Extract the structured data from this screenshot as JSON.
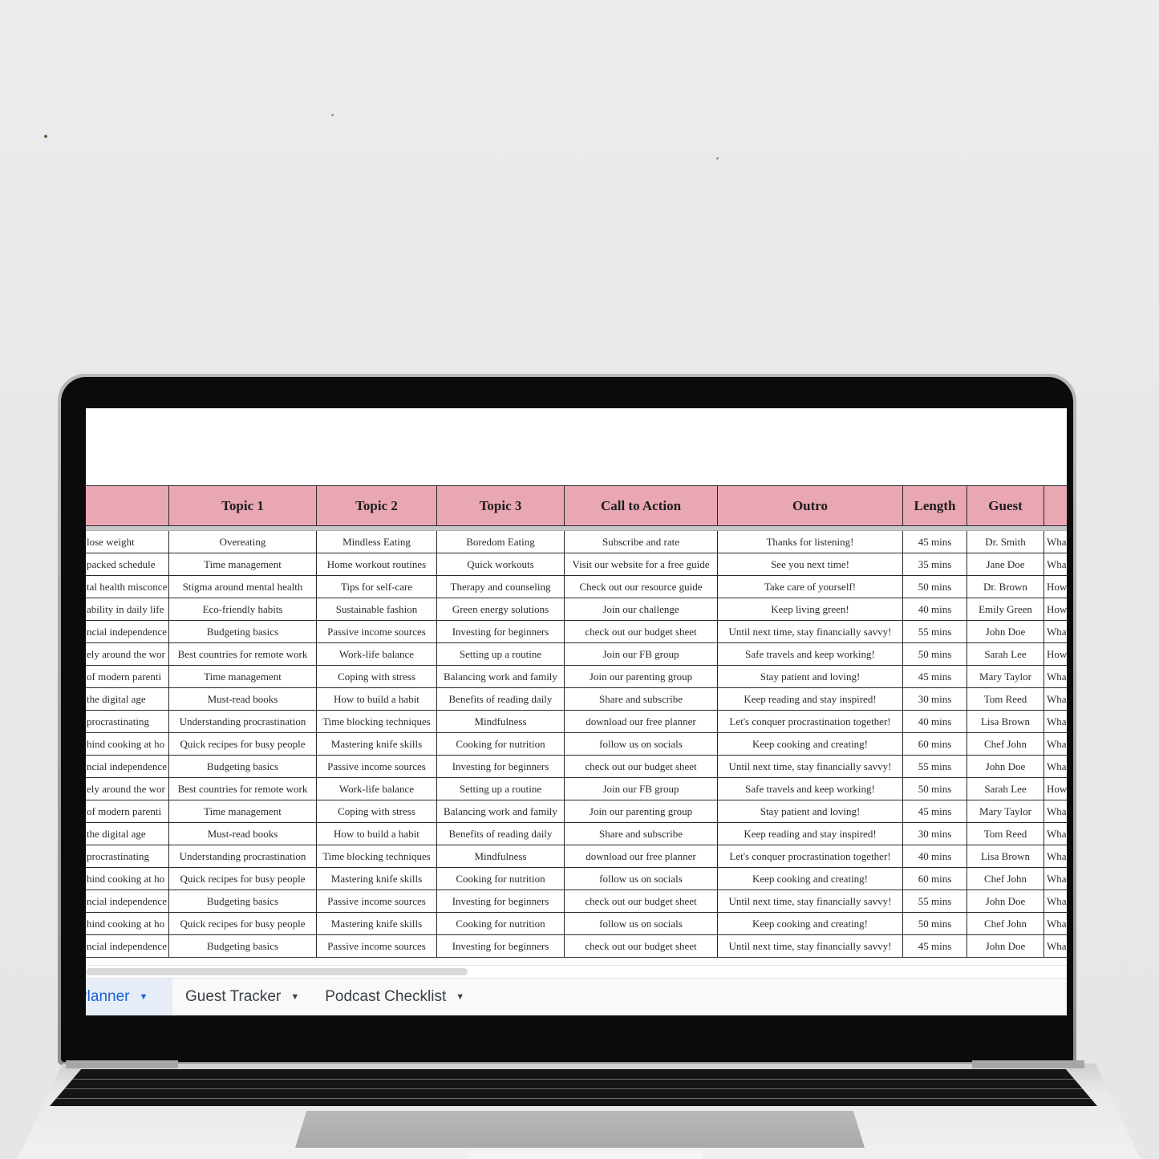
{
  "spreadsheet": {
    "columns": [
      {
        "label": ""
      },
      {
        "label": "Topic 1"
      },
      {
        "label": "Topic 2"
      },
      {
        "label": "Topic 3"
      },
      {
        "label": "Call to Action"
      },
      {
        "label": "Outro"
      },
      {
        "label": "Length"
      },
      {
        "label": "Guest"
      },
      {
        "label": ""
      }
    ],
    "rows": [
      [
        "lose weight",
        "Overeating",
        "Mindless Eating",
        "Boredom Eating",
        "Subscribe and rate",
        "Thanks for listening!",
        "45 mins",
        "Dr. Smith",
        "Wha"
      ],
      [
        "packed schedule",
        "Time management",
        "Home workout routines",
        "Quick workouts",
        "Visit our website for a free guide",
        "See you next time!",
        "35 mins",
        "Jane Doe",
        "Wha"
      ],
      [
        "tal health misconce",
        "Stigma around mental health",
        "Tips for self-care",
        "Therapy and counseling",
        "Check out our resource guide",
        "Take care of yourself!",
        "50 mins",
        "Dr. Brown",
        "How"
      ],
      [
        "ability in daily life",
        "Eco-friendly habits",
        "Sustainable fashion",
        "Green energy solutions",
        "Join our challenge",
        "Keep living green!",
        "40 mins",
        "Emily Green",
        "How"
      ],
      [
        "ncial independence",
        "Budgeting basics",
        "Passive income sources",
        "Investing for beginners",
        "check out our budget sheet",
        "Until next time, stay financially savvy!",
        "55 mins",
        "John Doe",
        "Wha"
      ],
      [
        "ely around the wor",
        "Best countries for remote work",
        "Work-life balance",
        "Setting up a routine",
        "Join our FB group",
        "Safe travels and keep working!",
        "50 mins",
        "Sarah Lee",
        "How"
      ],
      [
        "of modern parenti",
        "Time management",
        "Coping with stress",
        "Balancing work and family",
        "Join our parenting group",
        "Stay patient and loving!",
        "45 mins",
        "Mary Taylor",
        "Wha"
      ],
      [
        "the digital age",
        "Must-read books",
        "How to build a habit",
        "Benefits of reading daily",
        "Share and subscribe",
        "Keep reading and stay inspired!",
        "30 mins",
        "Tom Reed",
        "Wha"
      ],
      [
        "procrastinating",
        "Understanding procrastination",
        "Time blocking techniques",
        "Mindfulness",
        "download our free planner",
        "Let's conquer procrastination together!",
        "40 mins",
        "Lisa Brown",
        "Wha"
      ],
      [
        "hind cooking at ho",
        "Quick recipes for busy people",
        "Mastering knife skills",
        "Cooking for nutrition",
        "follow us on socials",
        "Keep cooking and creating!",
        "60 mins",
        "Chef John",
        "Wha"
      ],
      [
        "ncial independence",
        "Budgeting basics",
        "Passive income sources",
        "Investing for beginners",
        "check out our budget sheet",
        "Until next time, stay financially savvy!",
        "55 mins",
        "John Doe",
        "Wha"
      ],
      [
        "ely around the wor",
        "Best countries for remote work",
        "Work-life balance",
        "Setting up a routine",
        "Join our FB group",
        "Safe travels and keep working!",
        "50 mins",
        "Sarah Lee",
        "How"
      ],
      [
        "of modern parenti",
        "Time management",
        "Coping with stress",
        "Balancing work and family",
        "Join our parenting group",
        "Stay patient and loving!",
        "45 mins",
        "Mary Taylor",
        "Wha"
      ],
      [
        "the digital age",
        "Must-read books",
        "How to build a habit",
        "Benefits of reading daily",
        "Share and subscribe",
        "Keep reading and stay inspired!",
        "30 mins",
        "Tom Reed",
        "Wha"
      ],
      [
        "procrastinating",
        "Understanding procrastination",
        "Time blocking techniques",
        "Mindfulness",
        "download our free planner",
        "Let's conquer procrastination together!",
        "40 mins",
        "Lisa Brown",
        "Wha"
      ],
      [
        "hind cooking at ho",
        "Quick recipes for busy people",
        "Mastering knife skills",
        "Cooking for nutrition",
        "follow us on socials",
        "Keep cooking and creating!",
        "60 mins",
        "Chef John",
        "Wha"
      ],
      [
        "ncial independence",
        "Budgeting basics",
        "Passive income sources",
        "Investing for beginners",
        "check out our budget sheet",
        "Until next time, stay financially savvy!",
        "55 mins",
        "John Doe",
        "Wha"
      ],
      [
        "hind cooking at ho",
        "Quick recipes for busy people",
        "Mastering knife skills",
        "Cooking for nutrition",
        "follow us on socials",
        "Keep cooking and creating!",
        "50 mins",
        "Chef John",
        "Wha"
      ],
      [
        "ncial independence",
        "Budgeting basics",
        "Passive income sources",
        "Investing for beginners",
        "check out our budget sheet",
        "Until next time, stay financially savvy!",
        "45 mins",
        "John Doe",
        "Wha"
      ]
    ],
    "colors": {
      "header_bg": "#e8a7b3",
      "active_tab_text": "#1a64d2",
      "active_tab_bg": "#e6edf8"
    }
  },
  "sheet_tabs": [
    {
      "label": "Planner",
      "active": true,
      "icon": "caret-down-icon"
    },
    {
      "label": "Guest Tracker",
      "active": false,
      "icon": "caret-down-icon"
    },
    {
      "label": "Podcast Checklist",
      "active": false,
      "icon": "caret-down-icon"
    }
  ]
}
